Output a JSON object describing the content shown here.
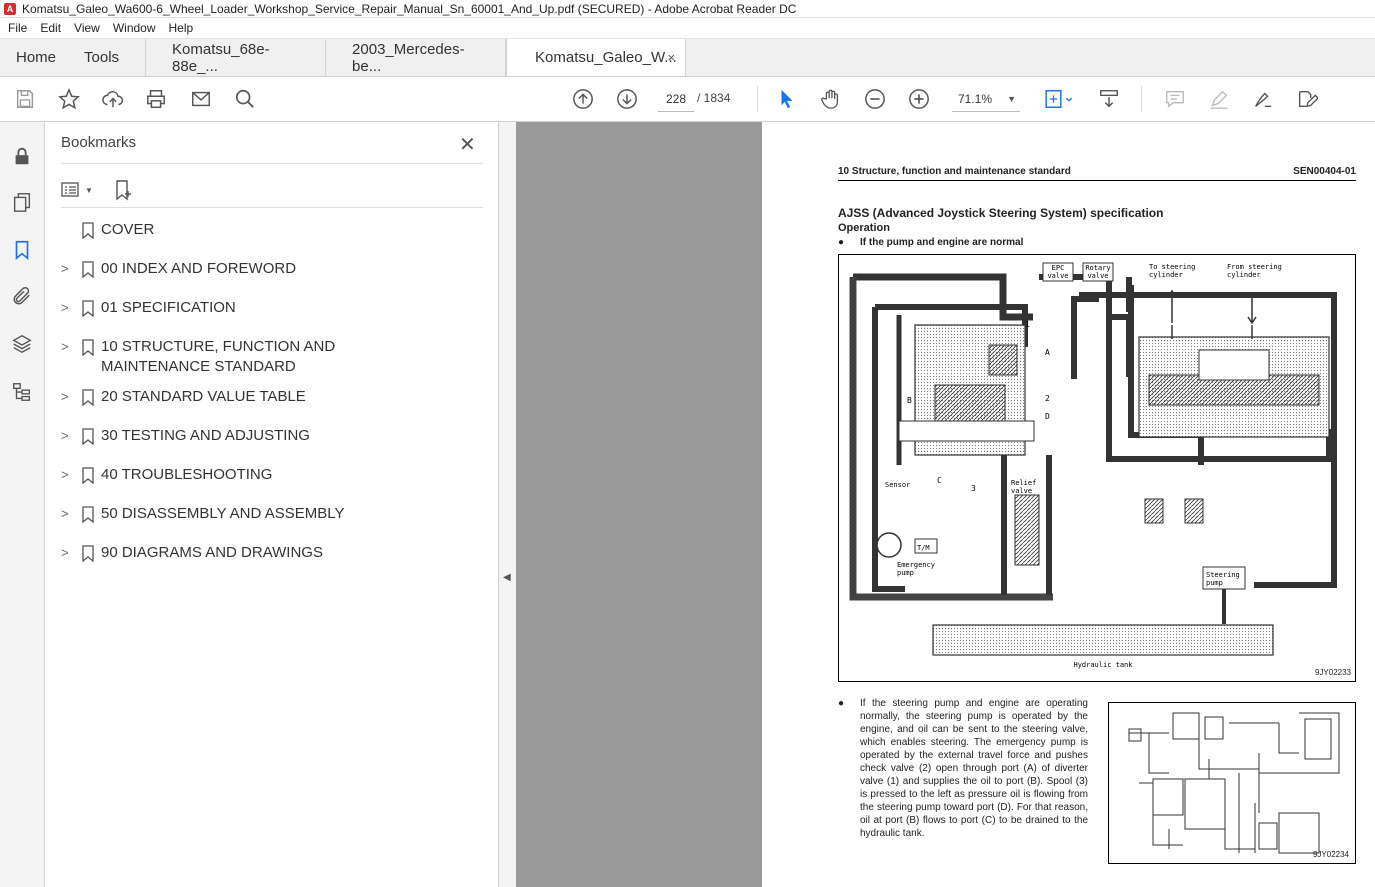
{
  "window": {
    "title": "Komatsu_Galeo_Wa600-6_Wheel_Loader_Workshop_Service_Repair_Manual_Sn_60001_And_Up.pdf (SECURED) - Adobe Acrobat Reader DC"
  },
  "menu": [
    "File",
    "Edit",
    "View",
    "Window",
    "Help"
  ],
  "tabs": {
    "home": "Home",
    "tools": "Tools",
    "docs": [
      "Komatsu_68e-88e_...",
      "2003_Mercedes-be...",
      "Komatsu_Galeo_W..."
    ],
    "close": "×"
  },
  "toolbar": {
    "page_current": "228",
    "page_total": "/ 1834",
    "zoom": "71.1%"
  },
  "bookmarks": {
    "title": "Bookmarks",
    "close": "✕",
    "items": [
      {
        "label": "COVER",
        "expandable": false
      },
      {
        "label": "00 INDEX AND FOREWORD",
        "expandable": true
      },
      {
        "label": "01 SPECIFICATION",
        "expandable": true
      },
      {
        "label": "10 STRUCTURE, FUNCTION AND MAINTENANCE STANDARD",
        "expandable": true
      },
      {
        "label": "20 STANDARD VALUE TABLE",
        "expandable": true
      },
      {
        "label": "30 TESTING AND ADJUSTING",
        "expandable": true
      },
      {
        "label": "40 TROUBLESHOOTING",
        "expandable": true
      },
      {
        "label": "50 DISASSEMBLY AND ASSEMBLY",
        "expandable": true
      },
      {
        "label": "90 DIAGRAMS AND DRAWINGS",
        "expandable": true
      }
    ]
  },
  "page": {
    "header_left": "10 Structure, function and maintenance standard",
    "header_right": "SEN00404-01",
    "heading": "AJSS (Advanced Joystick Steering System) specification",
    "subheading": "Operation",
    "bullet1": "If the pump and engine are normal",
    "fig1_labels": {
      "epc": "EPC valve",
      "rotary": "Rotary valve",
      "to_cyl": "To steering cylinder",
      "from_cyl": "From steering cylinder",
      "sensor": "Sensor",
      "relief": "Relief valve",
      "tm": "T/M",
      "emergency": "Emergency pump",
      "steering_pump": "Steering pump",
      "tank": "Hydraulic tank",
      "a": "A",
      "b": "B",
      "c": "C",
      "d": "D",
      "n1": "1",
      "n2": "2",
      "n3": "3"
    },
    "fig1_id": "9JY02233",
    "paragraph": "If the steering pump and engine are operating normally, the steering pump is operated by the engine, and oil can be sent to the steering valve, which enables steering. The emergency pump is operated by the external travel force and pushes check valve (2) open through port (A) of diverter valve (1) and supplies the oil to port (B). Spool (3) is pressed to the left as pressure oil is flowing from the steering pump toward port (D). For that reason, oil at port (B) flows to port (C) to be drained to the hydraulic tank.",
    "fig2_id": "9JY02234"
  }
}
